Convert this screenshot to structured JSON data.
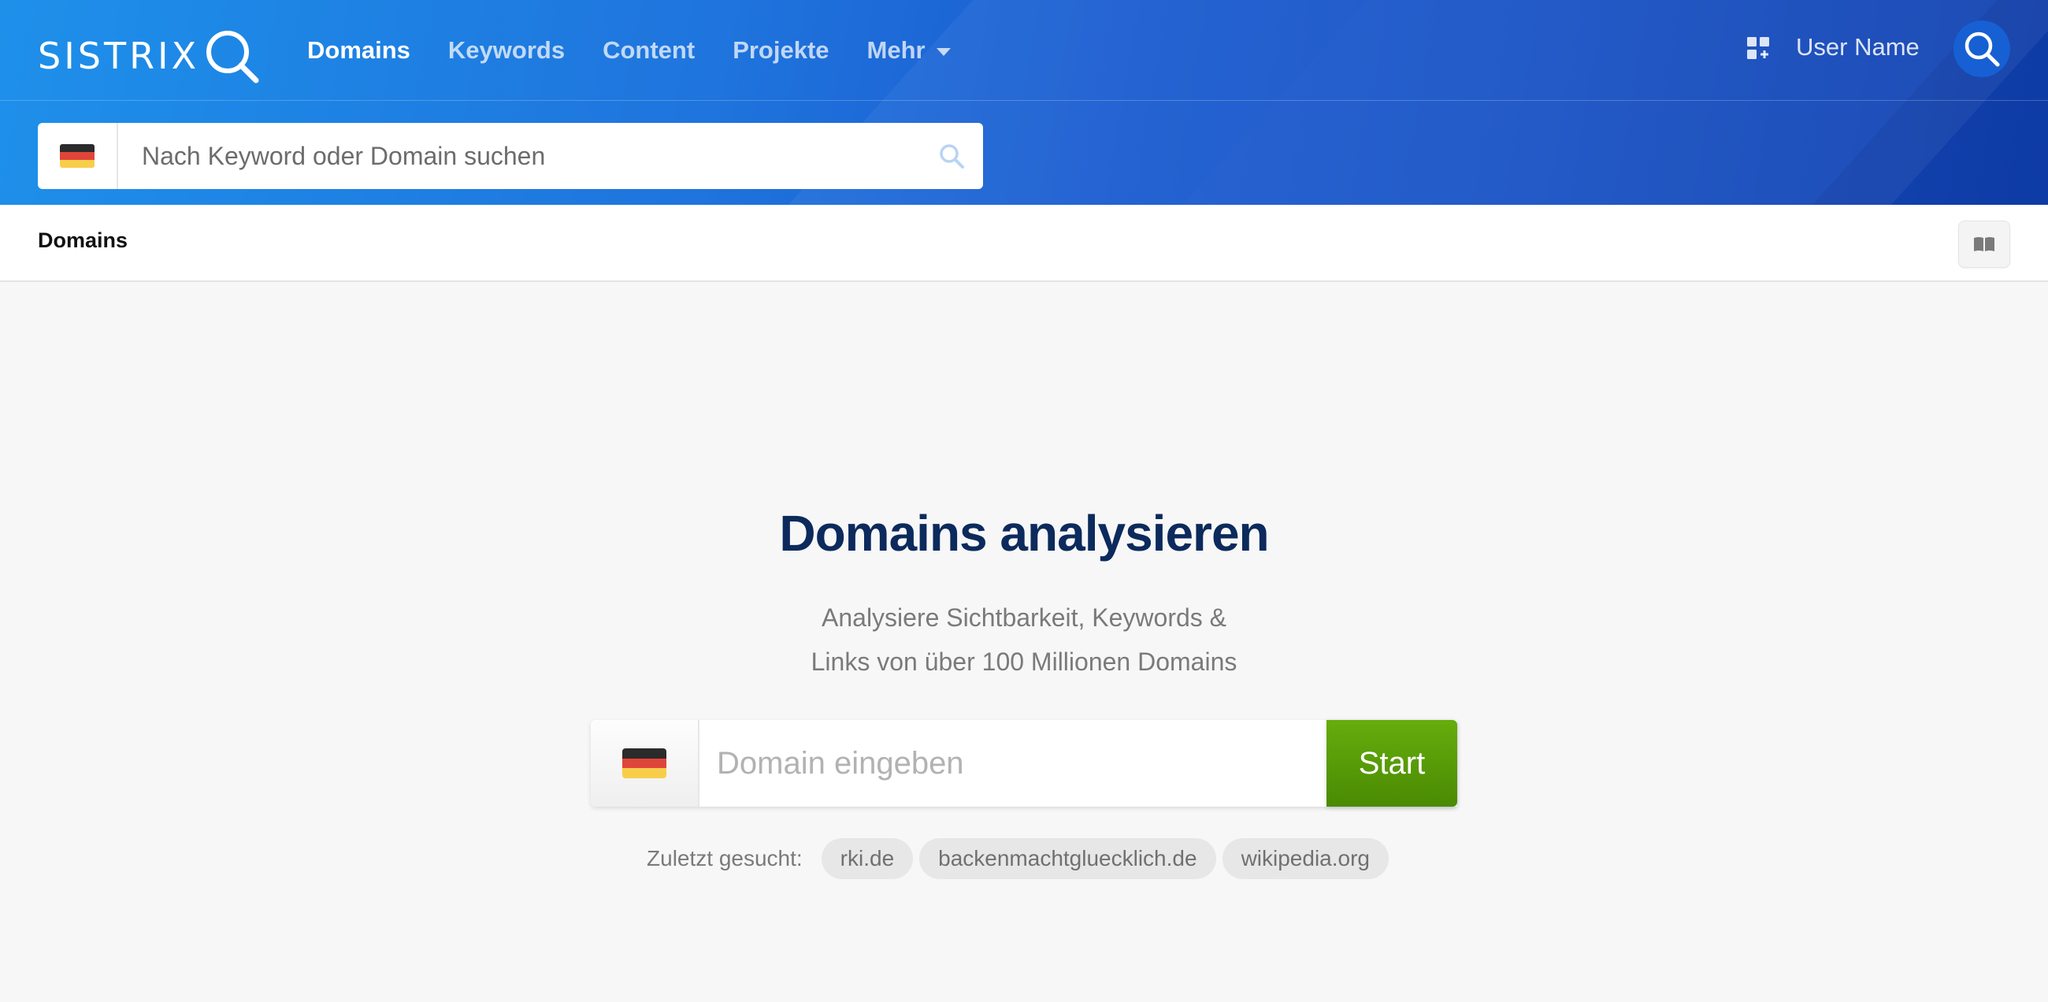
{
  "brand": {
    "logo_text": "SISTRIX"
  },
  "nav": {
    "items": [
      {
        "label": "Domains",
        "active": true
      },
      {
        "label": "Keywords",
        "active": false
      },
      {
        "label": "Content",
        "active": false
      },
      {
        "label": "Projekte",
        "active": false
      },
      {
        "label": "Mehr",
        "active": false,
        "has_dropdown": true
      }
    ]
  },
  "user": {
    "name": "User Name"
  },
  "top_search": {
    "placeholder": "Nach Keyword oder Domain suchen",
    "country_flag": "germany-flag-icon"
  },
  "breadcrumb": {
    "title": "Domains"
  },
  "main": {
    "title": "Domains analysieren",
    "subtitle_line1": "Analysiere Sichtbarkeit, Keywords &",
    "subtitle_line2": "Links von über 100 Millionen Domains",
    "domain_input": {
      "placeholder": "Domain eingeben",
      "value": ""
    },
    "start_label": "Start",
    "recent_label": "Zuletzt gesucht:",
    "recent": [
      "rki.de",
      "backenmachtgluecklich.de",
      "wikipedia.org"
    ]
  },
  "colors": {
    "header_gradient_start": "#1e90ea",
    "header_gradient_end": "#0f3fae",
    "title_color": "#0c2a5c",
    "start_button": "#5a9c08",
    "chip_bg": "#e7e7e7"
  }
}
